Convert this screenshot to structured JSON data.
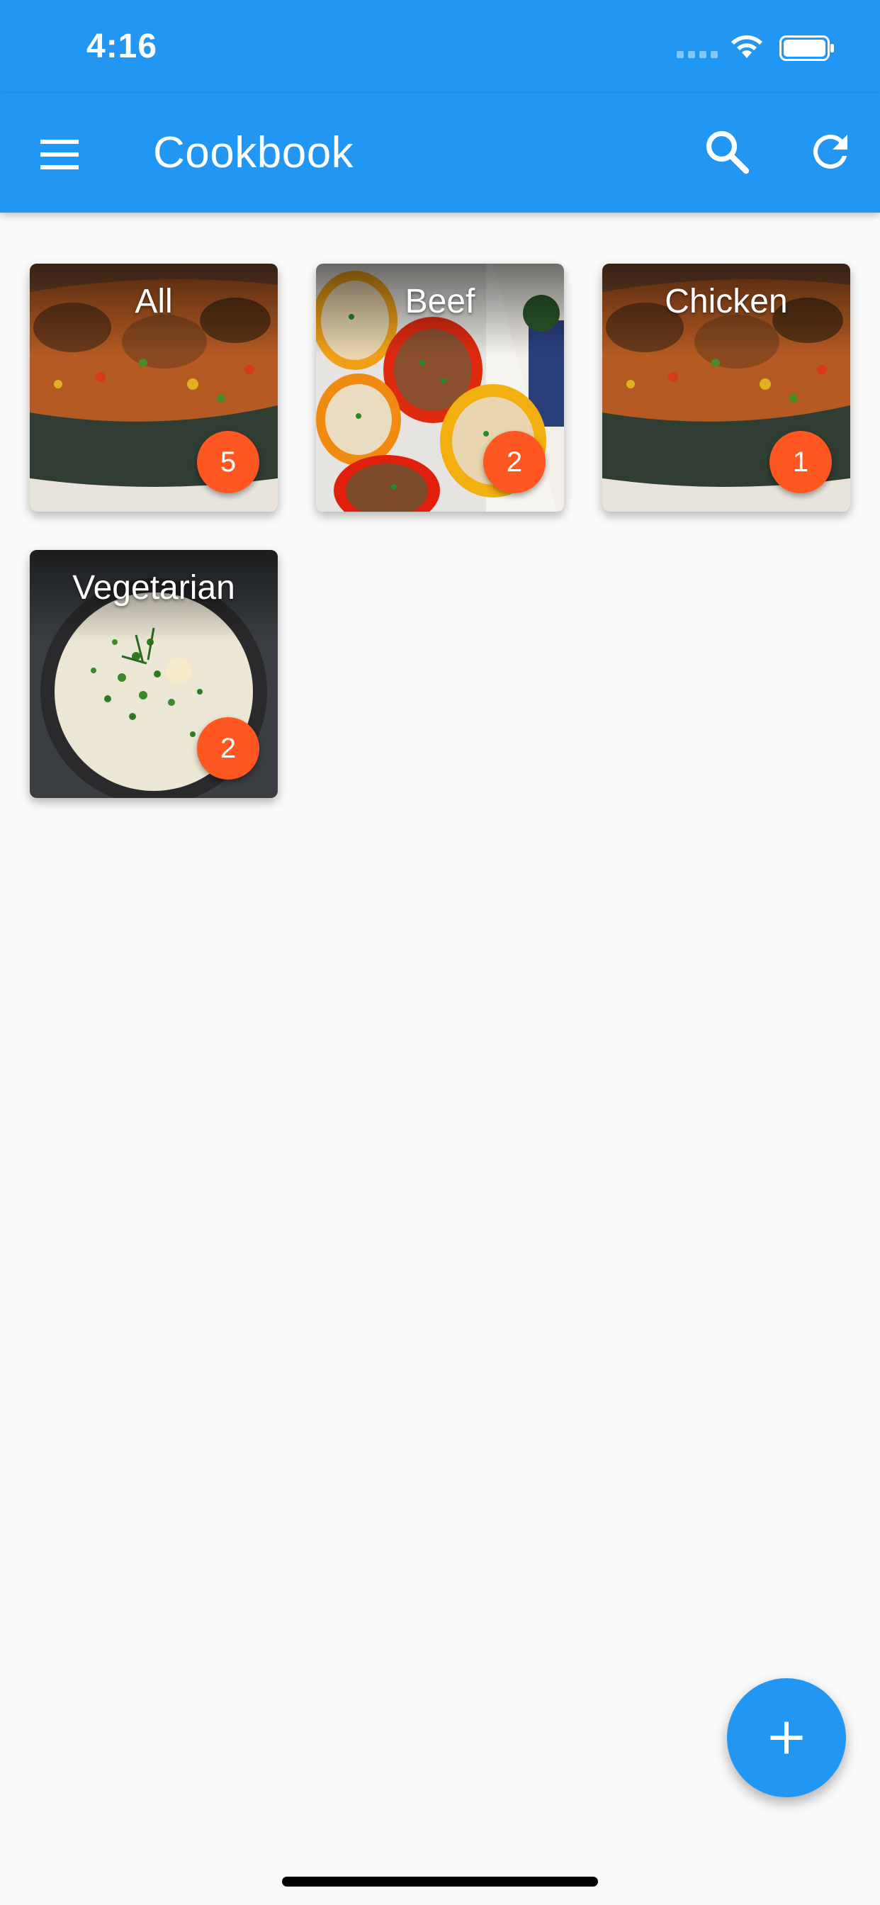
{
  "status_bar": {
    "time": "4:16",
    "signal_icon": "cellular-signal-icon",
    "wifi_icon": "wifi-icon",
    "battery_icon": "battery-icon"
  },
  "app_bar": {
    "title": "Cookbook",
    "menu_icon": "menu-icon",
    "search_icon": "search-icon",
    "refresh_icon": "refresh-icon",
    "color": "#2196F3"
  },
  "categories": [
    {
      "label": "All",
      "count": "5",
      "image": "chicken-skillet-photo"
    },
    {
      "label": "Beef",
      "count": "2",
      "image": "stuffed-peppers-photo"
    },
    {
      "label": "Chicken",
      "count": "1",
      "image": "chicken-skillet-photo"
    },
    {
      "label": "Vegetarian",
      "count": "2",
      "image": "risotto-bowl-photo"
    }
  ],
  "badge_color": "#FF5722",
  "fab": {
    "icon": "plus-icon",
    "color": "#2196F3"
  }
}
